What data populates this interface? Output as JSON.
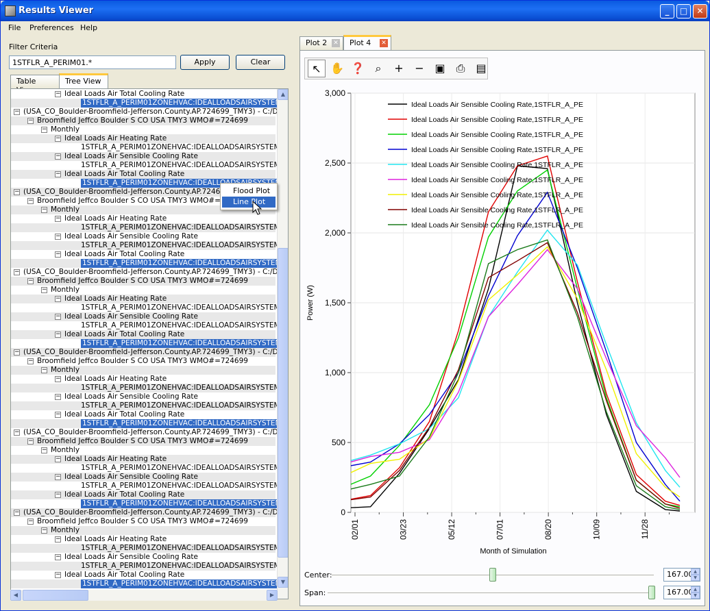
{
  "window": {
    "title": "Results Viewer",
    "min_glyph": "_",
    "max_glyph": "□",
    "close_glyph": "✕"
  },
  "menubar": {
    "items": [
      "File",
      "Preferences",
      "Help"
    ]
  },
  "filter": {
    "label": "Filter Criteria",
    "value": "1STFLR_A_PERIM01.*",
    "apply_label": "Apply",
    "clear_label": "Clear"
  },
  "left_tabs": [
    "Table View",
    "Tree View"
  ],
  "left_active_tab": "Tree View",
  "tree": {
    "top_variable": "Ideal Loads Air Total Cooling Rate",
    "top_series": "1STFLR_A_PERIM01ZONEHVAC:IDEALLOADSAIRSYSTEM",
    "env_label": "(USA_CO_Boulder-Broomfield-Jefferson.County.AP.724699_TMY3) - C:/Doc",
    "station_label": "Broomfield Jeffco  Boulder   S CO USA TMY3 WMO#=724699",
    "freq_label": "Monthly",
    "variables": [
      "Ideal Loads Air Heating Rate",
      "Ideal Loads Air Sensible Cooling Rate",
      "Ideal Loads Air Total Cooling Rate"
    ],
    "series": "1STFLR_A_PERIM01ZONEHVAC:IDEALLOADSAIRSYSTEM",
    "group_count": 6
  },
  "context_menu": {
    "items": [
      "Flood Plot",
      "Line Plot"
    ],
    "highlighted": "Line Plot"
  },
  "right_tabs": [
    {
      "label": "Plot 2",
      "close": "✕"
    },
    {
      "label": "Plot 4",
      "close": "✕"
    }
  ],
  "right_active_tab": "Plot 4",
  "toolbar": {
    "tools": [
      "select-arrow-icon",
      "pan-hand-icon",
      "query-help-icon",
      "zoom-box-icon",
      "zoom-in-icon",
      "zoom-out-icon",
      "save-icon",
      "print-icon",
      "page-icon"
    ],
    "glyphs": [
      "↖",
      "✋",
      "❓",
      "⌕",
      "+",
      "−",
      "▣",
      "⎙",
      "▤"
    ]
  },
  "chart_data": {
    "type": "line",
    "xlabel": "Month of Simulation",
    "ylabel": "Power (W)",
    "ylim": [
      0,
      3000
    ],
    "yticks": [
      0,
      500,
      1000,
      1500,
      2000,
      2500,
      3000
    ],
    "ytick_labels": [
      "0",
      "500",
      "1,000",
      "1,500",
      "2,000",
      "2,500",
      "3,000"
    ],
    "xtick_labels": [
      "02/01",
      "03/23",
      "05/12",
      "07/01",
      "08/20",
      "10/09",
      "11/28"
    ],
    "x_days": [
      0,
      50,
      100,
      150,
      200,
      250,
      300
    ],
    "x_range_days": [
      0,
      336
    ],
    "grid": true,
    "legend_placement": "top-left",
    "series": [
      {
        "name": "Ideal Loads Air Sensible Cooling Rate,1STFLR_A_PE",
        "color": "#000000",
        "x": [
          -15,
          16,
          46,
          77,
          107,
          138,
          168,
          199,
          230,
          260,
          291,
          321,
          336
        ],
        "values": [
          30,
          40,
          280,
          600,
          950,
          1600,
          2480,
          2460,
          1500,
          700,
          150,
          20,
          10
        ]
      },
      {
        "name": "Ideal Loads Air Sensible Cooling Rate,1STFLR_A_PE",
        "color": "#e00000",
        "x": [
          -15,
          16,
          46,
          77,
          107,
          138,
          168,
          199,
          230,
          260,
          291,
          321,
          336
        ],
        "values": [
          80,
          120,
          320,
          650,
          1300,
          2150,
          2480,
          2550,
          1650,
          850,
          270,
          80,
          50
        ]
      },
      {
        "name": "Ideal Loads Air Sensible Cooling Rate,1STFLR_A_PE",
        "color": "#00d000",
        "x": [
          -15,
          16,
          46,
          77,
          107,
          138,
          168,
          199,
          230,
          260,
          291,
          321,
          336
        ],
        "values": [
          170,
          260,
          480,
          770,
          1250,
          1970,
          2300,
          2450,
          1600,
          820,
          230,
          60,
          40
        ]
      },
      {
        "name": "Ideal Loads Air Sensible Cooling Rate,1STFLR_A_PE",
        "color": "#0000d0",
        "x": [
          -15,
          16,
          46,
          77,
          107,
          138,
          168,
          199,
          230,
          260,
          291,
          321,
          336
        ],
        "values": [
          320,
          360,
          490,
          700,
          1000,
          1550,
          1980,
          2290,
          1750,
          1150,
          500,
          200,
          80
        ]
      },
      {
        "name": "Ideal Loads Air Sensible Cooling Rate,1STFLR_A_PE",
        "color": "#22e5f0",
        "x": [
          -15,
          16,
          46,
          77,
          107,
          138,
          168,
          199,
          230,
          260,
          291,
          321,
          336
        ],
        "values": [
          350,
          410,
          490,
          600,
          820,
          1400,
          1720,
          2020,
          1770,
          1200,
          640,
          300,
          180
        ]
      },
      {
        "name": "Ideal Loads Air Sensible Cooling Rate,1STFLR_A_PE",
        "color": "#dd22dd",
        "x": [
          -15,
          16,
          46,
          77,
          107,
          138,
          168,
          199,
          230,
          260,
          291,
          321,
          336
        ],
        "values": [
          340,
          400,
          430,
          520,
          860,
          1400,
          1630,
          1880,
          1600,
          1100,
          620,
          390,
          250
        ]
      },
      {
        "name": "Ideal Loads Air Sensible Cooling Rate,1STFLR_A_PE",
        "color": "#f0f000",
        "x": [
          -15,
          16,
          46,
          77,
          107,
          138,
          168,
          199,
          230,
          260,
          291,
          321,
          336
        ],
        "values": [
          250,
          350,
          380,
          530,
          940,
          1520,
          1700,
          1900,
          1530,
          1020,
          420,
          180,
          110
        ]
      },
      {
        "name": "Ideal Loads Air Sensible Cooling Rate,1STFLR_A_PE",
        "color": "#800000",
        "x": [
          -15,
          16,
          46,
          77,
          107,
          138,
          168,
          199,
          230,
          260,
          291,
          321,
          336
        ],
        "values": [
          80,
          110,
          300,
          610,
          1020,
          1680,
          1800,
          1930,
          1430,
          800,
          230,
          60,
          30
        ]
      },
      {
        "name": "Ideal Loads Air Sensible Cooling Rate,1STFLR_A_PE",
        "color": "#1a7a1a",
        "x": [
          -15,
          16,
          46,
          77,
          107,
          138,
          168,
          199,
          230,
          260,
          291,
          321,
          336
        ],
        "values": [
          150,
          200,
          260,
          540,
          1000,
          1780,
          1880,
          1950,
          1400,
          720,
          190,
          40,
          20
        ]
      }
    ]
  },
  "center": {
    "label": "Center:",
    "value": "167.00",
    "position": 0.5
  },
  "span": {
    "label": "Span:",
    "value": "167.00",
    "position": 1.0
  },
  "tree_scroll_thumb": {
    "start": 0.31,
    "end": 0.96
  }
}
